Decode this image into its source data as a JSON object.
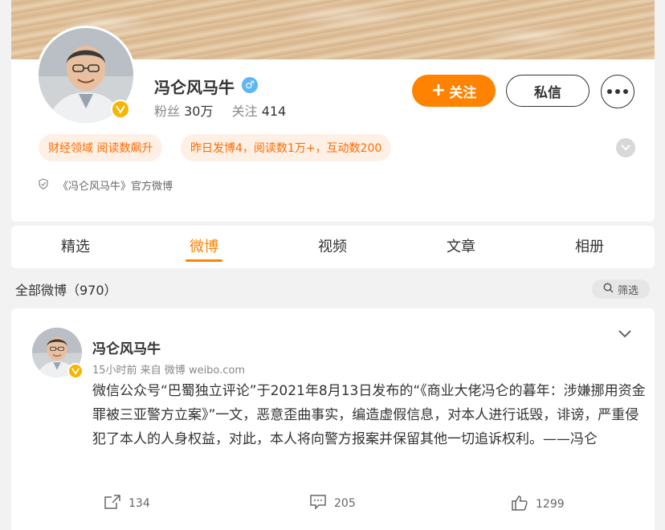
{
  "profile": {
    "name": "冯仑风马牛",
    "gender_icon": "male-icon",
    "followers_label": "粉丝",
    "followers_value": "30万",
    "following_label": "关注",
    "following_value": "414",
    "follow_button": "关注",
    "message_button": "私信",
    "tags": [
      "财经领域 阅读数飙升",
      "昨日发博4，阅读数1万+，互动数200"
    ],
    "official_text": "《冯仑风马牛》官方微博"
  },
  "tabs": [
    "精选",
    "微博",
    "视频",
    "文章",
    "相册"
  ],
  "active_tab": "微博",
  "feed": {
    "count_label": "全部微博（970）",
    "filter_label": "筛选"
  },
  "post": {
    "author": "冯仑风马牛",
    "meta": "15小时前  来自 微博 weibo.com",
    "text": "微信公众号“巴蜀独立评论”于2021年8月13日发布的“《商业大佬冯仑的暮年：涉嫌挪用资金罪被三亚警方立案》”一文，恶意歪曲事实，编造虚假信息，对本人进行诋毁，诽谤，严重侵犯了本人的人身权益，对此，本人将向警方报案并保留其他一切追诉权利。——冯仑",
    "reposts": "134",
    "comments": "205",
    "likes": "1299"
  },
  "colors": {
    "accent": "#ff8200",
    "verified": "#f7b500",
    "tag_bg": "#fff0e6",
    "tag_text": "#ff6a00"
  }
}
